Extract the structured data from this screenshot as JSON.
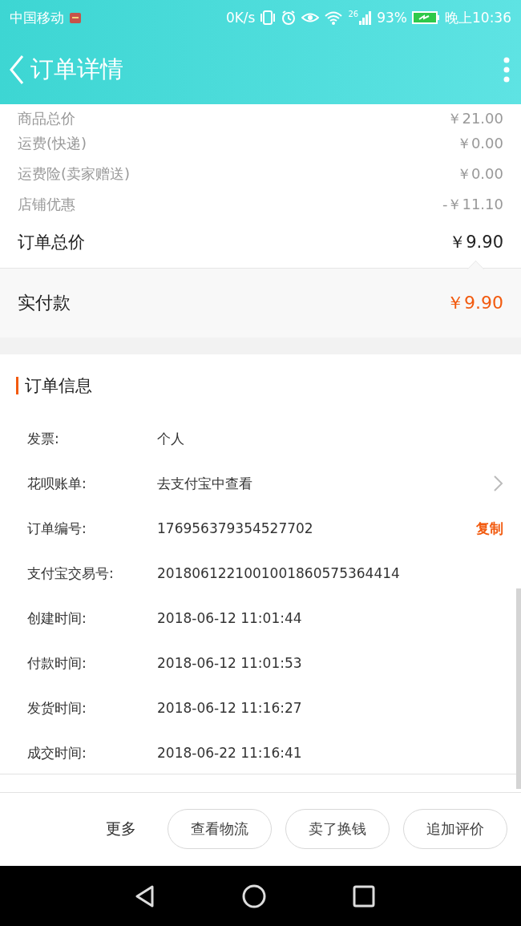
{
  "status_bar": {
    "carrier": "中国移动",
    "speed": "0K/s",
    "signal_label": "26",
    "battery": "93%",
    "time": "晚上10:36"
  },
  "header": {
    "title": "订单详情"
  },
  "price_rows": [
    {
      "label": "商品总价",
      "value": "￥21.00"
    },
    {
      "label": "运费(快递)",
      "value": "￥0.00"
    },
    {
      "label": "运费险(卖家赠送)",
      "value": "￥0.00"
    },
    {
      "label": "店铺优惠",
      "value": "-￥11.10"
    }
  ],
  "order_total": {
    "label": "订单总价",
    "value": "￥9.90"
  },
  "paid": {
    "label": "实付款",
    "value": "￥9.90"
  },
  "order_info": {
    "title": "订单信息",
    "rows": [
      {
        "kind": "plain",
        "label": "发票:",
        "value": "个人"
      },
      {
        "kind": "link",
        "label": "花呗账单:",
        "value": "去支付宝中查看"
      },
      {
        "kind": "copy",
        "label": "订单编号:",
        "value": "176956379354527702",
        "action": "复制"
      },
      {
        "kind": "plain",
        "label": "支付宝交易号:",
        "value": "2018061221001001860575364414"
      },
      {
        "kind": "plain",
        "label": "创建时间:",
        "value": "2018-06-12 11:01:44"
      },
      {
        "kind": "plain",
        "label": "付款时间:",
        "value": "2018-06-12 11:01:53"
      },
      {
        "kind": "plain",
        "label": "发货时间:",
        "value": "2018-06-12 11:16:27"
      },
      {
        "kind": "plain",
        "label": "成交时间:",
        "value": "2018-06-22 11:16:41"
      }
    ]
  },
  "bottom_bar": {
    "more": "更多",
    "buttons": [
      "查看物流",
      "卖了换钱",
      "追加评价"
    ]
  }
}
